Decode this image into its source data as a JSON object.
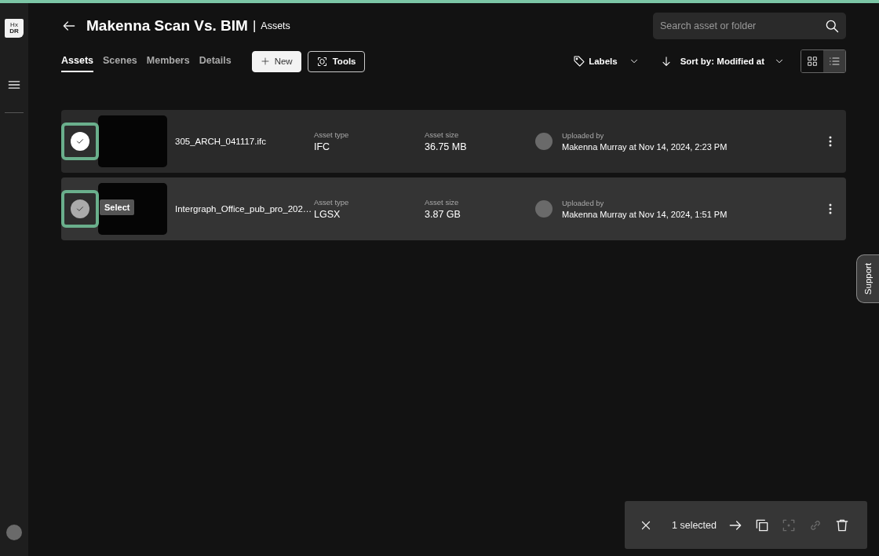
{
  "sidebar": {
    "logo_top": "Hx",
    "logo_bottom": "DR"
  },
  "header": {
    "title": "Makenna Scan Vs. BIM",
    "separator": "|",
    "section": "Assets",
    "search": {
      "placeholder": "Search asset or folder"
    }
  },
  "tabs": [
    {
      "label": "Assets",
      "selected": true
    },
    {
      "label": "Scenes",
      "selected": false
    },
    {
      "label": "Members",
      "selected": false
    },
    {
      "label": "Details",
      "selected": false
    }
  ],
  "buttons": [
    {
      "kind": "new",
      "label": "New"
    },
    {
      "kind": "tools",
      "label": "Tools"
    }
  ],
  "filters": {
    "labels": "Labels",
    "sort_prefix": "Sort by:",
    "sort_value": "Modified at"
  },
  "views": [
    {
      "kind": "grid",
      "selected": false
    },
    {
      "kind": "list",
      "selected": true
    }
  ],
  "assets": [
    {
      "name": "305_ARCH_041117.ifc",
      "selected": true,
      "hovered": false,
      "type_label": "Asset type",
      "type": "IFC",
      "size_label": "Asset size",
      "size": "36.75 MB",
      "uploaded_label": "Uploaded by",
      "uploaded": "Makenna Murray at Nov 14, 2024, 2:23 PM"
    },
    {
      "name": "Intergraph_Office_pub_pro_202…",
      "selected": false,
      "hovered": true,
      "tooltip": "Select",
      "type_label": "Asset type",
      "type": "LGSX",
      "size_label": "Asset size",
      "size": "3.87 GB",
      "uploaded_label": "Uploaded by",
      "uploaded": "Makenna Murray at Nov 14, 2024, 1:51 PM"
    }
  ],
  "support_tab": "Support",
  "selection_bar": {
    "count": "1 selected",
    "actions": [
      {
        "kind": "move",
        "disabled": false
      },
      {
        "kind": "copy",
        "disabled": false
      },
      {
        "kind": "focus",
        "disabled": true
      },
      {
        "kind": "link",
        "disabled": true
      },
      {
        "kind": "delete",
        "disabled": false
      }
    ]
  }
}
